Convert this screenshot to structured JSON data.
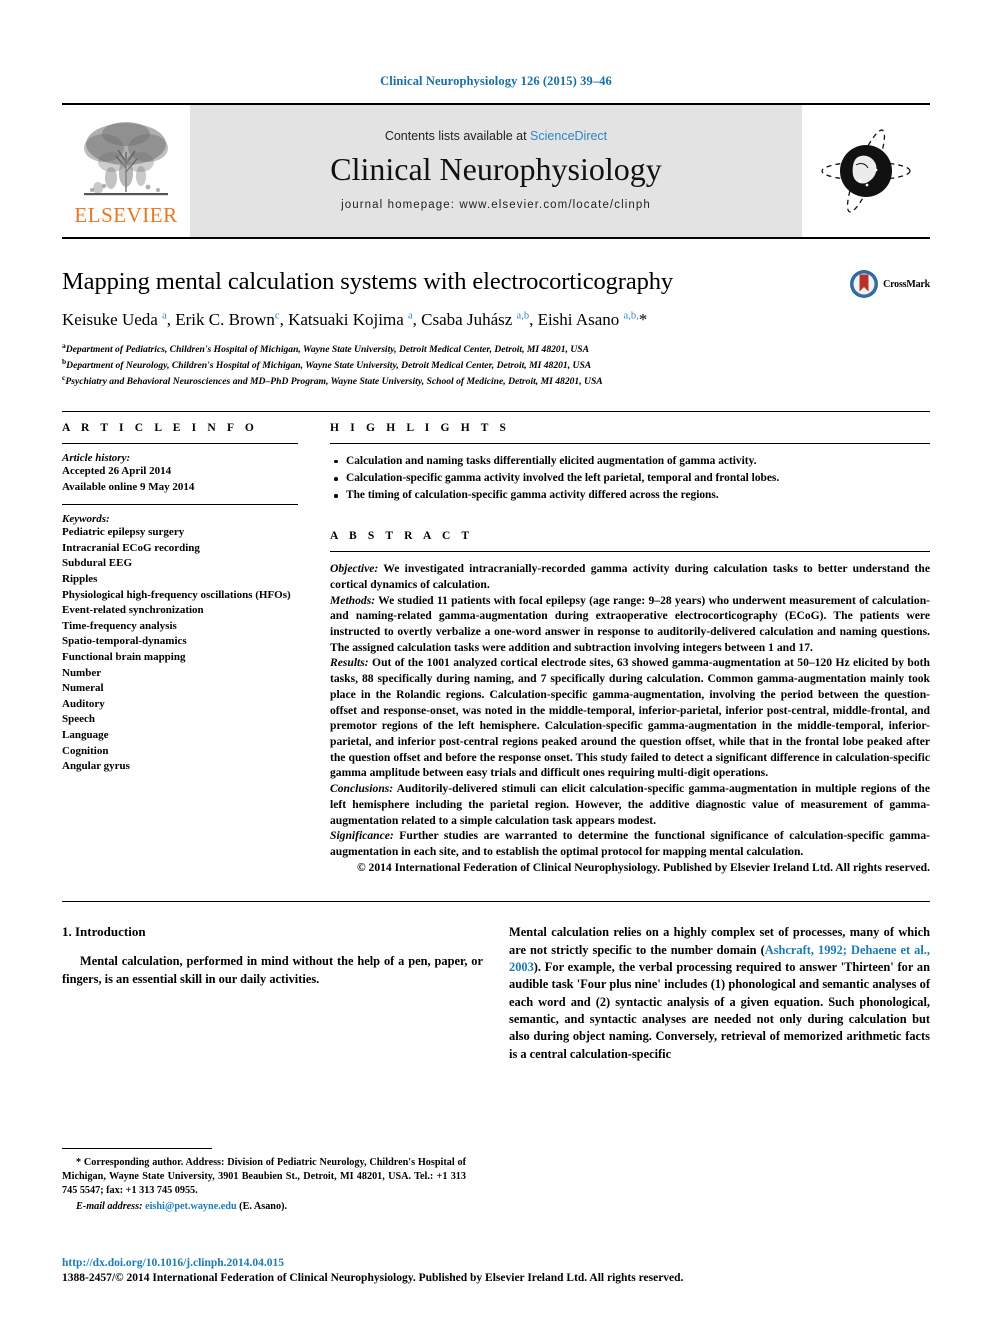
{
  "running_head": "Clinical Neurophysiology 126 (2015) 39–46",
  "masthead": {
    "contents_prefix": "Contents lists available at ",
    "sciencedirect": "ScienceDirect",
    "journal_name": "Clinical Neurophysiology",
    "homepage": "journal homepage: www.elsevier.com/locate/clinph",
    "publisher_wordmark": "ELSEVIER",
    "publisher_logo_icon": "elsevier-tree-icon",
    "journal_emblem_icon": "journal-globe-emblem-icon"
  },
  "article": {
    "title": "Mapping mental calculation systems with electrocorticography",
    "authors_html": "Keisuke Ueda <sup>a</sup>, Erik C. Brown<sup>c</sup>, Katsuaki Kojima <sup>a</sup>, Csaba Juhász <sup>a,b</sup>, Eishi Asano <sup>a,b,</sup>*",
    "affiliations": [
      {
        "marker": "a",
        "text": "Department of Pediatrics, Children's Hospital of Michigan, Wayne State University, Detroit Medical Center, Detroit, MI 48201, USA"
      },
      {
        "marker": "b",
        "text": "Department of Neurology, Children's Hospital of Michigan, Wayne State University, Detroit Medical Center, Detroit, MI 48201, USA"
      },
      {
        "marker": "c",
        "text": "Psychiatry and Behavioral Neurosciences and MD–PhD Program, Wayne State University, School of Medicine, Detroit, MI 48201, USA"
      }
    ],
    "crossmark_label": "CrossMark",
    "crossmark_icon": "crossmark-badge-icon"
  },
  "article_info": {
    "heading": "A R T I C L E  I N F O",
    "history_label": "Article history:",
    "history": [
      "Accepted 26 April 2014",
      "Available online 9 May 2014"
    ],
    "keywords_label": "Keywords:",
    "keywords": [
      "Pediatric epilepsy surgery",
      "Intracranial ECoG recording",
      "Subdural EEG",
      "Ripples",
      "Physiological high-frequency oscillations (HFOs)",
      "Event-related synchronization",
      "Time-frequency analysis",
      "Spatio-temporal-dynamics",
      "Functional brain mapping",
      "Number",
      "Numeral",
      "Auditory",
      "Speech",
      "Language",
      "Cognition",
      "Angular gyrus"
    ]
  },
  "highlights": {
    "heading": "H I G H L I G H T S",
    "items": [
      "Calculation and naming tasks differentially elicited augmentation of gamma activity.",
      "Calculation-specific gamma activity involved the left parietal, temporal and frontal lobes.",
      "The timing of calculation-specific gamma activity differed across the regions."
    ]
  },
  "abstract": {
    "heading": "A B S T R A C T",
    "objective_label": "Objective:",
    "objective_text": " We investigated intracranially-recorded gamma activity during calculation tasks to better understand the cortical dynamics of calculation.",
    "methods_label": "Methods:",
    "methods_text": " We studied 11 patients with focal epilepsy (age range: 9–28 years) who underwent measurement of calculation- and naming-related gamma-augmentation during extraoperative electrocorticography (ECoG). The patients were instructed to overtly verbalize a one-word answer in response to auditorily-delivered calculation and naming questions. The assigned calculation tasks were addition and subtraction involving integers between 1 and 17.",
    "results_label": "Results:",
    "results_text": " Out of the 1001 analyzed cortical electrode sites, 63 showed gamma-augmentation at 50–120 Hz elicited by both tasks, 88 specifically during naming, and 7 specifically during calculation. Common gamma-augmentation mainly took place in the Rolandic regions. Calculation-specific gamma-augmentation, involving the period between the question-offset and response-onset, was noted in the middle-temporal, inferior-parietal, inferior post-central, middle-frontal, and premotor regions of the left hemisphere. Calculation-specific gamma-augmentation in the middle-temporal, inferior-parietal, and inferior post-central regions peaked around the question offset, while that in the frontal lobe peaked after the question offset and before the response onset. This study failed to detect a significant difference in calculation-specific gamma amplitude between easy trials and difficult ones requiring multi-digit operations.",
    "conclusions_label": "Conclusions:",
    "conclusions_text": " Auditorily-delivered stimuli can elicit calculation-specific gamma-augmentation in multiple regions of the left hemisphere including the parietal region. However, the additive diagnostic value of measurement of gamma-augmentation related to a simple calculation task appears modest.",
    "significance_label": "Significance:",
    "significance_text": " Further studies are warranted to determine the functional significance of calculation-specific gamma-augmentation in each site, and to establish the optimal protocol for mapping mental calculation.",
    "copyright": "© 2014 International Federation of Clinical Neurophysiology. Published by Elsevier Ireland Ltd. All rights reserved."
  },
  "introduction": {
    "section_title": "1. Introduction",
    "left_paragraph": "Mental calculation, performed in mind without the help of a pen, paper, or fingers, is an essential skill in our daily activities.",
    "right_paragraph_part1": "Mental calculation relies on a highly complex set of processes, many of which are not strictly specific to the number domain (",
    "right_citation": "Ashcraft, 1992; Dehaene et al., 2003",
    "right_paragraph_part2": "). For example, the verbal processing required to answer 'Thirteen' for an audible task 'Four plus nine' includes (1) phonological and semantic analyses of each word and (2) syntactic analysis of a given equation. Such phonological, semantic, and syntactic analyses are needed not only during calculation but also during object naming. Conversely, retrieval of memorized arithmetic facts is a central calculation-specific"
  },
  "footnotes": {
    "corresponding_marker": "*",
    "corresponding_text": " Corresponding author. Address: Division of Pediatric Neurology, Children's Hospital of Michigan, Wayne State University, 3901 Beaubien St., Detroit, MI 48201, USA. Tel.: +1 313 745 5547; fax: +1 313 745 0955.",
    "email_label": "E-mail address:",
    "email": "eishi@pet.wayne.edu",
    "email_suffix": " (E. Asano)."
  },
  "bottom": {
    "doi": "http://dx.doi.org/10.1016/j.clinph.2014.04.015",
    "issn_line": "1388-2457/© 2014 International Federation of Clinical Neurophysiology. Published by Elsevier Ireland Ltd. All rights reserved."
  },
  "colors": {
    "link_blue": "#1a7bb5",
    "sciencedirect_blue": "#2e86c8",
    "elsevier_orange": "#e87722",
    "masthead_gray": "#e3e3e3",
    "crossmark_red": "#b5332a",
    "crossmark_blue": "#2e6da4"
  }
}
